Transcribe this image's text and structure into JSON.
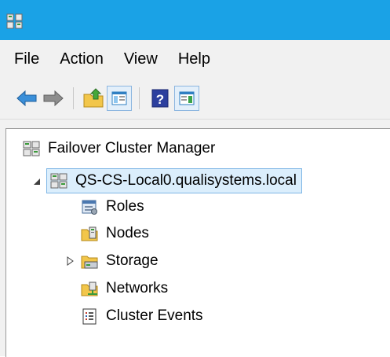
{
  "menu": {
    "items": [
      {
        "label": "File"
      },
      {
        "label": "Action"
      },
      {
        "label": "View"
      },
      {
        "label": "Help"
      }
    ]
  },
  "toolbar": {
    "buttons": [
      "back-arrow-icon",
      "forward-arrow-icon",
      "up-folder-icon",
      "show-hide-console-tree-icon",
      "help-icon",
      "show-hide-action-pane-icon"
    ]
  },
  "tree": {
    "root": "Failover Cluster Manager",
    "cluster": "QS-CS-Local0.qualisystems.local",
    "children": [
      {
        "label": "Roles"
      },
      {
        "label": "Nodes"
      },
      {
        "label": "Storage"
      },
      {
        "label": "Networks"
      },
      {
        "label": "Cluster Events"
      }
    ]
  },
  "colors": {
    "titlebar": "#1aa2e6",
    "chrome": "#f1f1f1",
    "selection": "#dbeefc",
    "selection_border": "#7fb6e6"
  }
}
